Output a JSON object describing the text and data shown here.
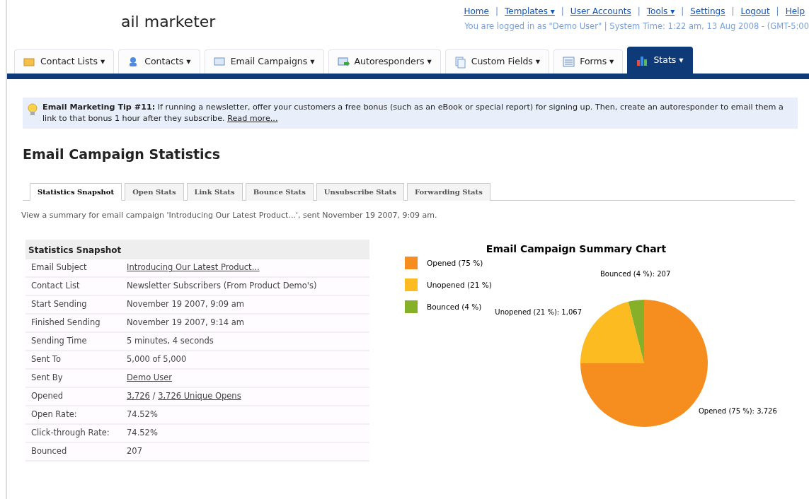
{
  "header": {
    "title_fragment": "ail marketer",
    "links": [
      {
        "label": "Home"
      },
      {
        "label": "Templates",
        "caret": "▾"
      },
      {
        "label": "User Accounts"
      },
      {
        "label": "Tools",
        "caret": "▾"
      },
      {
        "label": "Settings"
      },
      {
        "label": "Logout"
      },
      {
        "label": "Help"
      }
    ],
    "separators": [
      "|",
      "|",
      "|",
      "|",
      "|",
      "|"
    ],
    "status": "You are logged in as \"Demo User\" | System Time: 1:22 am, 13 Aug 2008 - (GMT-5:00"
  },
  "nav_tabs": [
    {
      "label": "Contact Lists",
      "caret": "▾",
      "kind": "lists",
      "selected": false
    },
    {
      "label": "Contacts",
      "caret": "▾",
      "kind": "contacts",
      "selected": false
    },
    {
      "label": "Email Campaigns",
      "caret": "▾",
      "kind": "campaigns",
      "selected": false
    },
    {
      "label": "Autoresponders",
      "caret": "▾",
      "kind": "autoresponders",
      "selected": false
    },
    {
      "label": "Custom Fields",
      "caret": "▾",
      "kind": "fields",
      "selected": false
    },
    {
      "label": "Forms",
      "caret": "▾",
      "kind": "forms",
      "selected": false
    },
    {
      "label": "Stats",
      "caret": "▾",
      "kind": "stats",
      "selected": true
    }
  ],
  "tip": {
    "text": "**Email Marketing Tip #11:** If running a newsletter, offer your customers a free bonus (such as an eBook or special report) for signing up. Then, create an autoresponder to email them a link to that bonus 1 hour after they subscribe.",
    "link": "Read more..."
  },
  "page_title": "Email Campaign Statistics",
  "sub_tabs": [
    {
      "label": "Statistics Snapshot",
      "selected": true
    },
    {
      "label": "Open Stats",
      "selected": false
    },
    {
      "label": "Link Stats",
      "selected": false
    },
    {
      "label": "Bounce Stats",
      "selected": false
    },
    {
      "label": "Unsubscribe Stats",
      "selected": false
    },
    {
      "label": "Forwarding Stats",
      "selected": false
    }
  ],
  "description": "View a summary for email campaign 'Introducing Our Latest Product...', sent November 19 2007, 9:09 am.",
  "snapshot": {
    "heading": "Statistics Snapshot",
    "rows": [
      {
        "label": "Email Subject",
        "value": [
          {
            "text": "Introducing Our Latest Product...",
            "link": true
          }
        ]
      },
      {
        "label": "Contact List",
        "value": [
          {
            "text": "Newsletter Subscribers (From Product Demo's)",
            "link": false
          }
        ]
      },
      {
        "label": "Start Sending",
        "value": [
          {
            "text": "November 19 2007, 9:09 am",
            "link": false
          }
        ]
      },
      {
        "label": "Finished Sending",
        "value": [
          {
            "text": "November 19 2007, 9:14 am",
            "link": false
          }
        ]
      },
      {
        "label": "Sending Time",
        "value": [
          {
            "text": "5 minutes, 4 seconds",
            "link": false
          }
        ]
      },
      {
        "label": "Sent To",
        "value": [
          {
            "text": "5,000 of 5,000",
            "link": false
          }
        ]
      },
      {
        "label": "Sent By",
        "value": [
          {
            "text": "Demo User",
            "link": true
          }
        ]
      },
      {
        "label": "Opened",
        "value": [
          {
            "text": "3,726",
            "link": true
          },
          {
            "text": " / ",
            "link": false
          },
          {
            "text": "3,726 Unique Opens",
            "link": true
          }
        ]
      },
      {
        "label": "Open Rate:",
        "value": [
          {
            "text": "74.52%",
            "link": false
          }
        ]
      },
      {
        "label": "Click-through Rate:",
        "value": [
          {
            "text": "74.52%",
            "link": false
          }
        ]
      },
      {
        "label": "Bounced",
        "value": [
          {
            "text": "207",
            "link": false
          }
        ]
      }
    ]
  },
  "chart": {
    "chart_data": {
      "type": "pie",
      "title": "Email Campaign Summary Chart",
      "categories": [
        "Opened (75 %)",
        "Unopened (21 %)",
        "Bounced (4 %)"
      ],
      "values": [
        75,
        21,
        4
      ],
      "colors": [
        "#f68d1f",
        "#fbbb21",
        "#86b027"
      ],
      "legend": "left",
      "value_labels": [
        "Opened (75 %): 3,726",
        "Unopened (21 %): 1,067",
        "Bounced (4 %): 207"
      ]
    }
  }
}
